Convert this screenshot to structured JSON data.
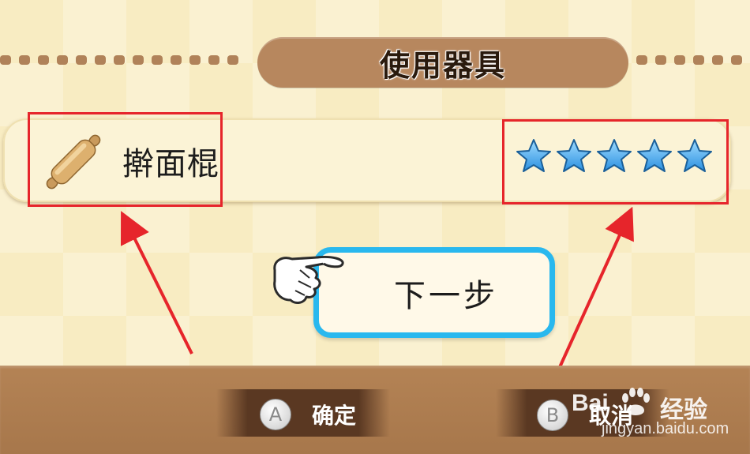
{
  "header": {
    "title": "使用器具"
  },
  "tool": {
    "name": "擀面棍",
    "icon": "rolling-pin-icon",
    "rating": 5,
    "rating_max": 5,
    "star_color": "#2a8fe0"
  },
  "next_button": {
    "label": "下一步"
  },
  "footer": {
    "confirm": {
      "key": "A",
      "label": "确定"
    },
    "cancel": {
      "key": "B",
      "label": "取消"
    }
  },
  "watermark": {
    "brand": "Bai",
    "brand_tail": "经验",
    "url": "jingyan.baidu.com"
  },
  "colors": {
    "highlight_box": "#e6252b",
    "arrow": "#e6252b",
    "button_border": "#29b8ee",
    "panel_brown": "#b7875e"
  }
}
